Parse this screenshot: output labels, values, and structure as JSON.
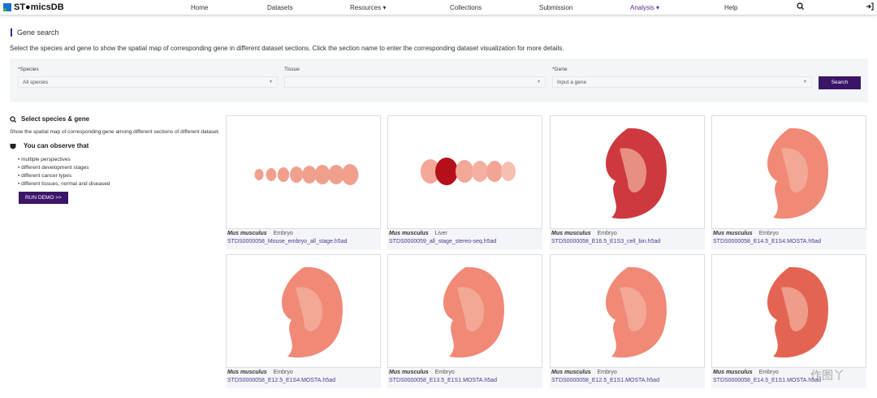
{
  "nav": {
    "brand": "ST●micsDB",
    "items": [
      {
        "label": "Home"
      },
      {
        "label": "Datasets"
      },
      {
        "label": "Resources ▾"
      },
      {
        "label": "Collections"
      },
      {
        "label": "Submission"
      },
      {
        "label": "Analysis ▾"
      },
      {
        "label": "Help"
      }
    ],
    "active": "Analysis"
  },
  "page": {
    "title": "Gene search",
    "description": "Select the species and gene to show the spatial map of corresponding gene in different dataset sections. Click the section name to enter the corresponding dataset visualization for more details."
  },
  "form": {
    "species_label": "*Species",
    "species_value": "All species",
    "tissue_label": "Tissue",
    "tissue_value": "",
    "gene_label": "*Gene",
    "gene_placeholder": "Input a gene",
    "search_label": "Search"
  },
  "sidebar": {
    "heading1": "Select species & gene",
    "text1": "Show the spatial map of corresponding gene among different sections of different dataset.",
    "heading2": "You can observe that",
    "bullets": [
      "multiple perspectives",
      "different development stages",
      "different cancer types",
      "different tissues, normal and diseased"
    ],
    "demo_label": "RUN DEMO >>"
  },
  "cards": [
    {
      "species": "Mus musculus",
      "tissue": "Embryo",
      "file": "STDS0000058_Mouse_embryo_all_stage.h5ad"
    },
    {
      "species": "Mus musculus",
      "tissue": "Liver",
      "file": "STDS0000059_all_stage_stereo-seq.h5ad"
    },
    {
      "species": "Mus musculus",
      "tissue": "Embryo",
      "file": "STDS0000058_E16.5_E1S3_cell_bin.h5ad"
    },
    {
      "species": "Mus musculus",
      "tissue": "Embryo",
      "file": "STDS0000058_E14.5_E1S4.MOSTA.h5ad"
    },
    {
      "species": "Mus musculus",
      "tissue": "Embryo",
      "file": "STDS0000058_E12.5_E1S4.MOSTA.h5ad"
    },
    {
      "species": "Mus musculus",
      "tissue": "Embryo",
      "file": "STDS0000058_E13.5_E1S1.MOSTA.h5ad"
    },
    {
      "species": "Mus musculus",
      "tissue": "Embryo",
      "file": "STDS0000058_E12.5_E1S1.MOSTA.h5ad"
    },
    {
      "species": "Mus musculus",
      "tissue": "Embryo",
      "file": "STDS0000058_E14.5_E1S1.MOSTA.h5ad"
    }
  ],
  "colors": {
    "accent": "#3b1468",
    "heat_low": "#f7b9a8",
    "heat_high": "#b5101a"
  },
  "watermark": "作图丫"
}
